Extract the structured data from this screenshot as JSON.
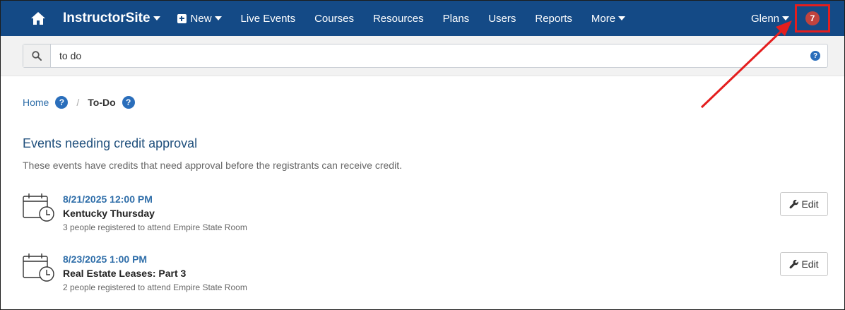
{
  "navbar": {
    "brand": "InstructorSite",
    "new_label": "New",
    "items": [
      "Live Events",
      "Courses",
      "Resources",
      "Plans",
      "Users",
      "Reports"
    ],
    "more_label": "More",
    "user_label": "Glenn",
    "notification_count": "7",
    "background_color": "#144a86",
    "badge_color": "#c0433e"
  },
  "search": {
    "value": "to do",
    "help_label": "?"
  },
  "breadcrumb": {
    "home_label": "Home",
    "separator": "/",
    "current_label": "To-Do",
    "help_label": "?"
  },
  "section": {
    "title": "Events needing credit approval",
    "description": "These events have credits that need approval before the registrants can receive credit."
  },
  "events": [
    {
      "datetime": "8/21/2025 12:00 PM",
      "name": "Kentucky Thursday",
      "meta": "3 people registered to attend Empire State Room",
      "edit_label": "Edit"
    },
    {
      "datetime": "8/23/2025 1:00 PM",
      "name": "Real Estate Leases: Part 3",
      "meta": "2 people registered to attend Empire State Room",
      "edit_label": "Edit"
    }
  ],
  "annotation": {
    "highlight_color": "#e41e1e"
  }
}
